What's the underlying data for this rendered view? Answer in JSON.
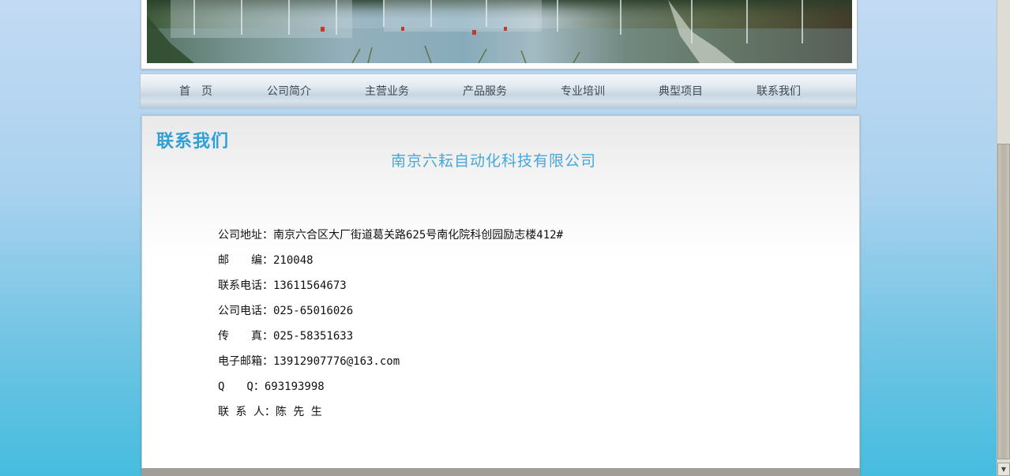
{
  "nav": {
    "items": [
      "首　页",
      "公司简介",
      "主营业务",
      "产品服务",
      "专业培训",
      "典型项目",
      "联系我们"
    ]
  },
  "content": {
    "section_title": "联系我们",
    "company_name": "南京六耘自动化科技有限公司",
    "info": [
      {
        "label": "公司地址：",
        "value": "南京六合区大厂街道葛关路625号南化院科创园励志楼412#"
      },
      {
        "label": "邮　　编：",
        "value": "210048"
      },
      {
        "label": "联系电话：",
        "value": "13611564673"
      },
      {
        "label": "公司电话：",
        "value": "025-65016026"
      },
      {
        "label": "传　　真：",
        "value": "025-58351633"
      },
      {
        "label": "电子邮箱：",
        "value": "13912907776@163.com"
      },
      {
        "label": "Q　　Q：",
        "value": "693193998"
      },
      {
        "label": "联 系 人：",
        "value": "陈 先 生"
      }
    ]
  },
  "colors": {
    "accent": "#2f9fd6",
    "company_name": "#46a8da",
    "nav_text": "#3d4a56"
  },
  "icons": {
    "scroll_down": "triangle-down-icon"
  }
}
